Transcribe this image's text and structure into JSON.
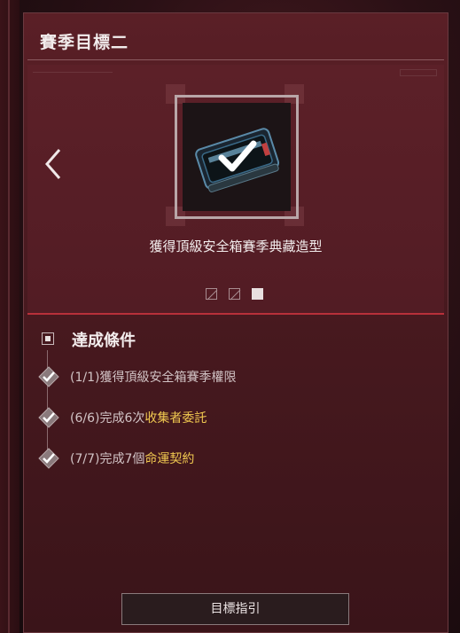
{
  "panel": {
    "title": "賽季目標二"
  },
  "showcase": {
    "item_name": "獲得頂級安全箱賽季典藏造型",
    "pager": {
      "count": 3,
      "active_index": 2
    },
    "icons": {
      "prev": "chevron-left-icon",
      "item": "secure-case-icon",
      "owned": "checkmark-icon"
    }
  },
  "conditions": {
    "title": "達成條件",
    "items": [
      {
        "progress": "(1/1)",
        "text": "獲得頂級安全箱賽季權限",
        "highlight": ""
      },
      {
        "progress": "(6/6)",
        "text": "完成6次",
        "highlight": "收集者委託"
      },
      {
        "progress": "(7/7)",
        "text": "完成7個",
        "highlight": "命運契約"
      }
    ]
  },
  "footer": {
    "button_label": "目標指引"
  },
  "colors": {
    "accent_line": "#b8303a",
    "highlight": "#f0c850",
    "panel": "#4a1a20"
  }
}
